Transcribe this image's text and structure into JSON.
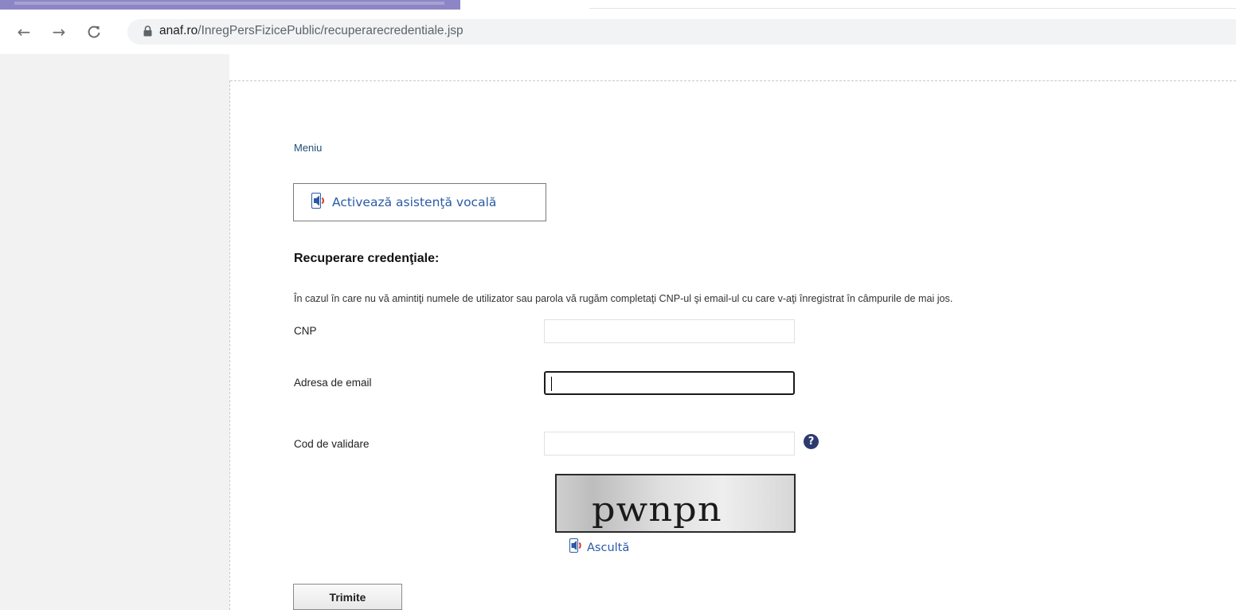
{
  "browser": {
    "url_host": "anaf.ro",
    "url_path": "/InregPersFizicePublic/recuperarecredentiale.jsp"
  },
  "page": {
    "menu_link": "Meniu",
    "voice_assist_label": "Activează asistenţă vocală",
    "heading": "Recuperare credenţiale:",
    "instructions": "În cazul în care nu vă amintiţi numele de utilizator sau parola vă rugăm completaţi CNP-ul şi email-ul cu care v-aţi înregistrat în câmpurile de mai jos.",
    "form": {
      "cnp_label": "CNP",
      "cnp_value": "",
      "email_label": "Adresa de email",
      "email_value": "",
      "validation_label": "Cod de validare",
      "validation_value": "",
      "help_symbol": "?",
      "captcha_text": "pwnpn",
      "listen_label": "Ascultă",
      "submit_label": "Trimite"
    }
  },
  "colors": {
    "link": "#1f4e79",
    "voice_text": "#2a5aa7",
    "help_icon": "#2d3a72"
  },
  "icons": [
    "back-arrow-icon",
    "forward-arrow-icon",
    "reload-icon",
    "lock-icon",
    "speaker-icon",
    "help-icon"
  ]
}
